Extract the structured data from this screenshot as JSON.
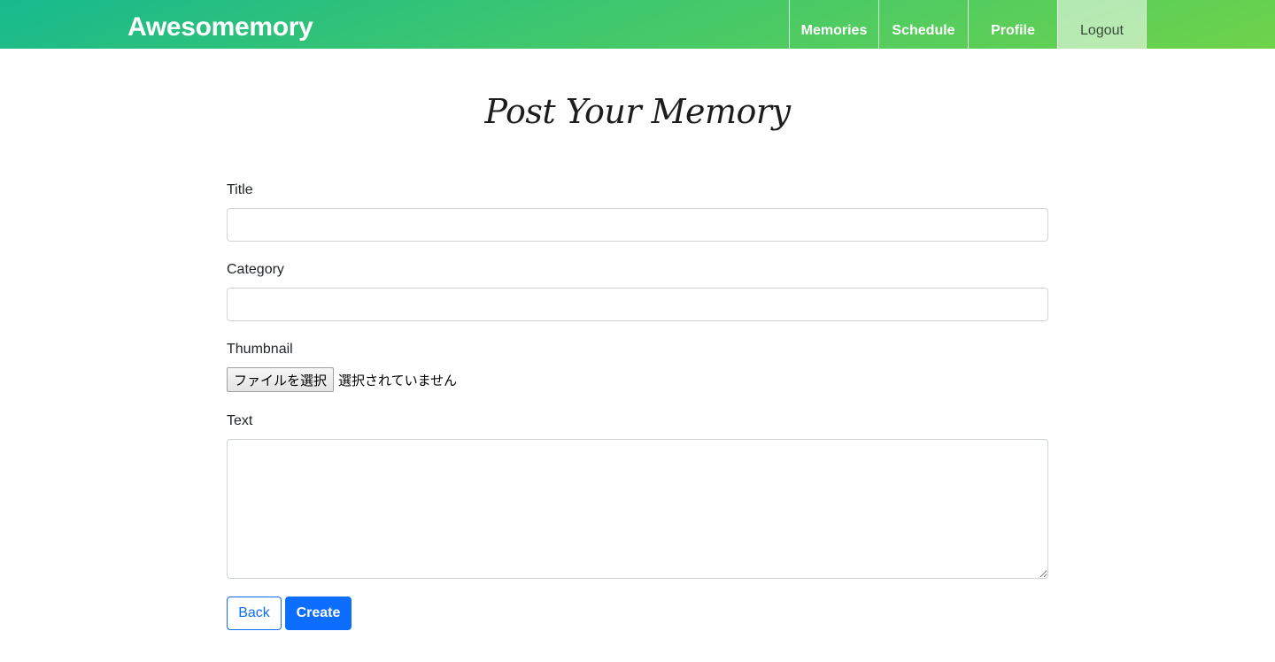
{
  "navbar": {
    "brand": "Awesomemory",
    "items": [
      {
        "label": "Memories"
      },
      {
        "label": "Schedule"
      },
      {
        "label": "Profile"
      },
      {
        "label": "Logout"
      }
    ]
  },
  "main": {
    "title": "Post Your Memory",
    "form": {
      "title_label": "Title",
      "title_value": "",
      "category_label": "Category",
      "category_value": "",
      "thumbnail_label": "Thumbnail",
      "file_button_label": "ファイルを選択",
      "file_status": "選択されていません",
      "text_label": "Text",
      "text_value": ""
    },
    "buttons": {
      "back_label": "Back",
      "create_label": "Create"
    }
  },
  "colors": {
    "navbar_gradient_start": "#17b98e",
    "navbar_gradient_end": "#6fd34a",
    "primary": "#0d6efd"
  }
}
